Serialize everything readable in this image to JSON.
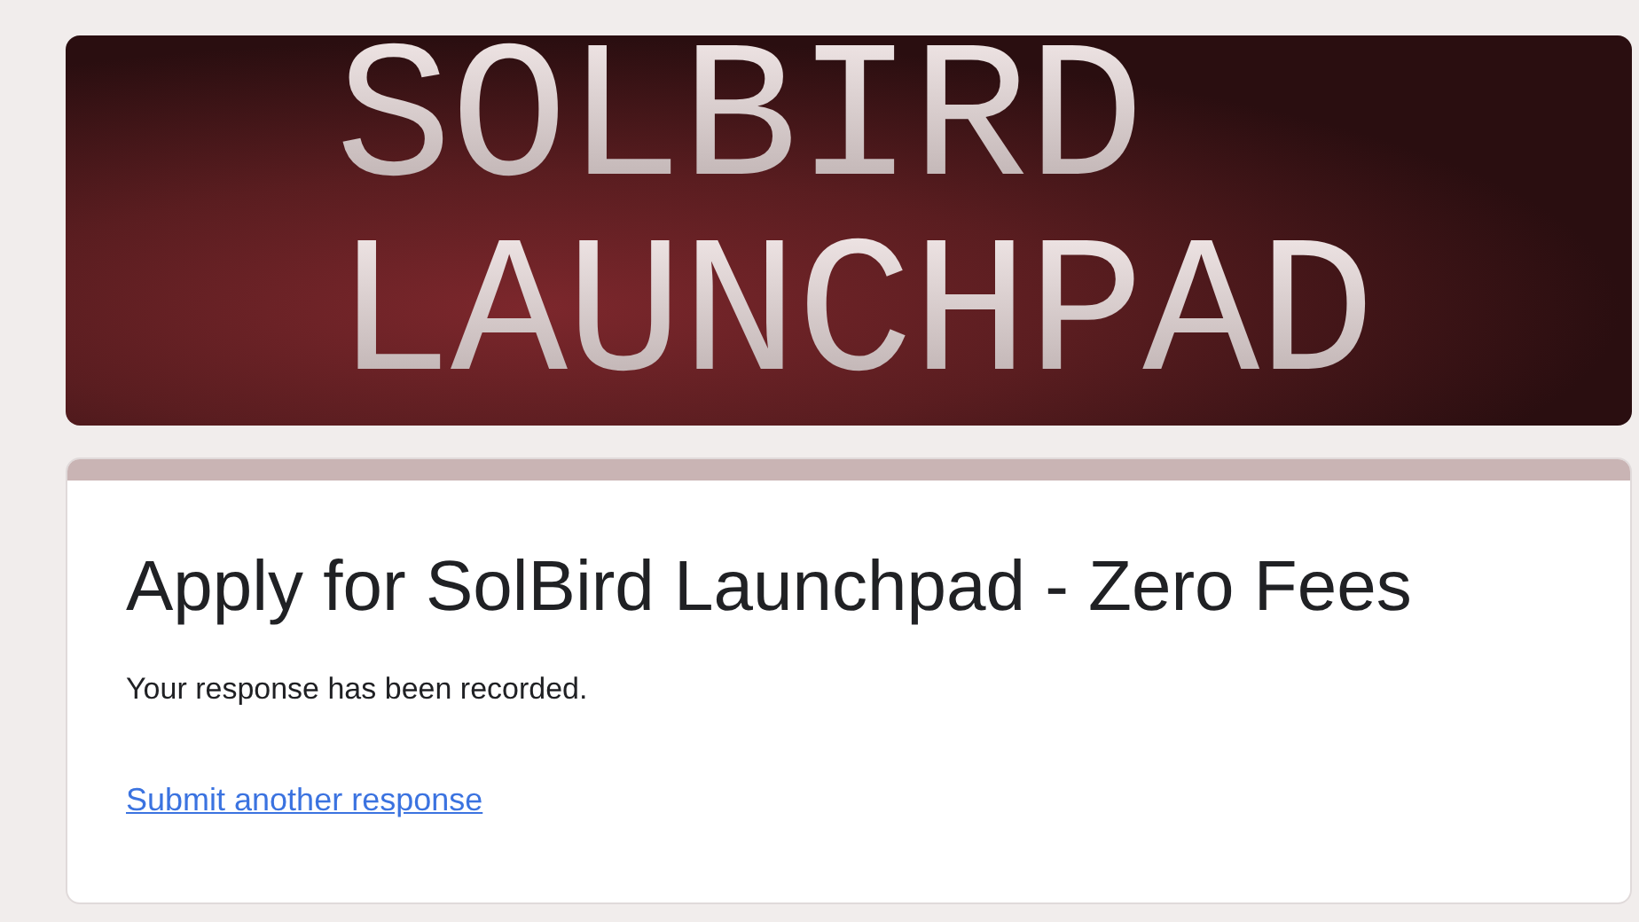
{
  "banner": {
    "lines": [
      "SOLBIRD",
      "LAUNCHPAD"
    ]
  },
  "form": {
    "title": "Apply for SolBird Launchpad - Zero Fees",
    "message": "Your response has been recorded.",
    "link": "Submit another response"
  }
}
